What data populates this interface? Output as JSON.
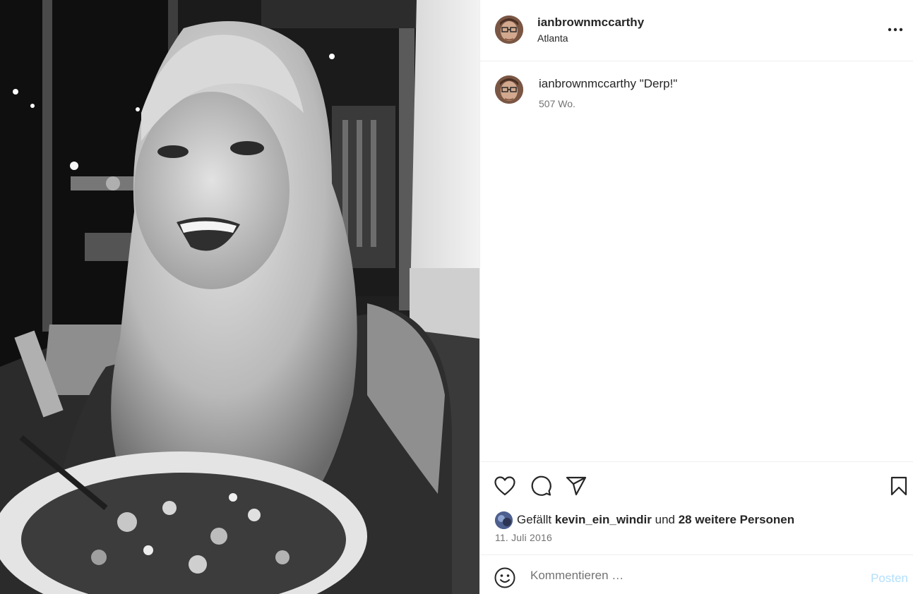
{
  "post": {
    "username": "ianbrownmccarthy",
    "location": "Atlanta",
    "caption_user": "ianbrownmccarthy",
    "caption_text": "\"Derp!\"",
    "caption_time": "507 Wo.",
    "likes_prefix": "Gefällt",
    "likes_user": "kevin_ein_windir",
    "likes_middle": "und",
    "likes_others": "28 weitere Personen",
    "date": "11. Juli 2016"
  },
  "comment": {
    "placeholder": "Kommentieren …",
    "post_label": "Posten"
  },
  "icons": {
    "more": "more-horizontal-icon",
    "like": "heart-icon",
    "comment": "speech-bubble-icon",
    "share": "paper-plane-icon",
    "save": "bookmark-icon",
    "emoji": "smiley-icon"
  },
  "colors": {
    "text": "#262626",
    "secondary": "#737373",
    "post_button": "#b2dffc",
    "divider": "#efefef"
  }
}
